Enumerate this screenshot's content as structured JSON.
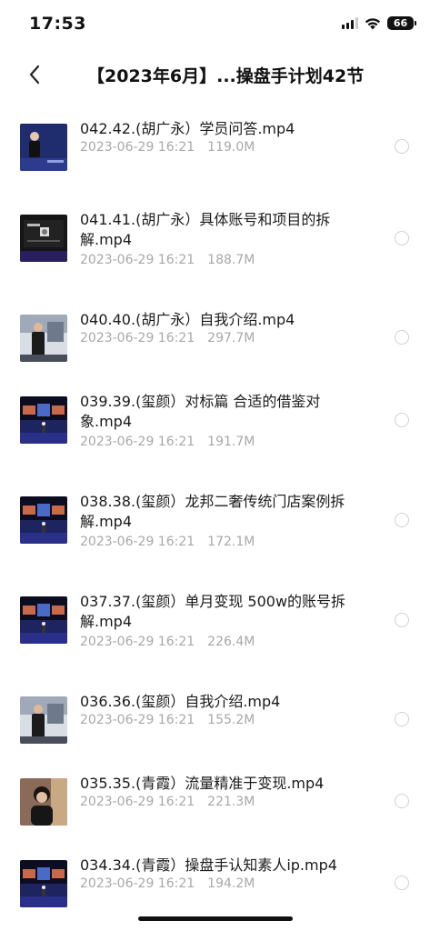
{
  "status_bar": {
    "time": "17:53",
    "battery": "66"
  },
  "nav": {
    "title": "【2023年6月】...操盘手计划42节"
  },
  "files": [
    {
      "name": "042.42.(胡广永）学员问答.mp4",
      "date": "2023-06-29 16:21",
      "size": "119.0M",
      "thumb": "speaker-dark"
    },
    {
      "name": "041.41.(胡广永）具体账号和项目的拆解.mp4",
      "date": "2023-06-29 16:21",
      "size": "188.7M",
      "thumb": "slide-dark"
    },
    {
      "name": "040.40.(胡广永）自我介绍.mp4",
      "date": "2023-06-29 16:21",
      "size": "297.7M",
      "thumb": "speaker-light"
    },
    {
      "name": "039.39.(玺颜）对标篇 合适的借鉴对象.mp4",
      "date": "2023-06-29 16:21",
      "size": "191.7M",
      "thumb": "stage-screens"
    },
    {
      "name": "038.38.(玺颜）龙邦二奢传统门店案例拆解.mp4",
      "date": "2023-06-29 16:21",
      "size": "172.1M",
      "thumb": "stage-screens"
    },
    {
      "name": "037.37.(玺颜）单月变现 500w的账号拆解.mp4",
      "date": "2023-06-29 16:21",
      "size": "226.4M",
      "thumb": "stage-screens"
    },
    {
      "name": "036.36.(玺颜）自我介绍.mp4",
      "date": "2023-06-29 16:21",
      "size": "155.2M",
      "thumb": "speaker-light"
    },
    {
      "name": "035.35.(青霞）流量精准于变现.mp4",
      "date": "2023-06-29 16:21",
      "size": "221.3M",
      "thumb": "portrait"
    },
    {
      "name": "034.34.(青霞）操盘手认知素人ip.mp4",
      "date": "2023-06-29 16:21",
      "size": "194.2M",
      "thumb": "stage-screens"
    }
  ]
}
